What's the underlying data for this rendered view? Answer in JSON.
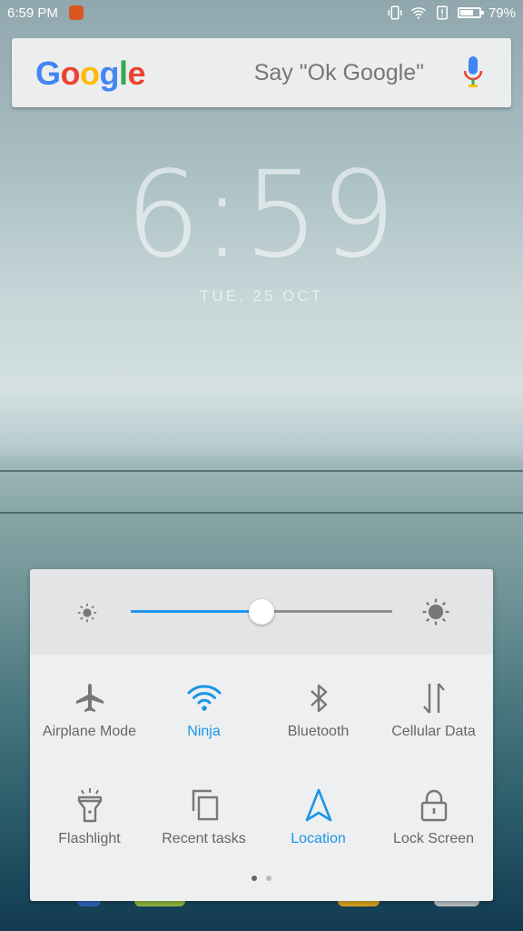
{
  "status_bar": {
    "time": "6:59 PM",
    "battery_percent": "79%",
    "battery_level": 0.79
  },
  "search": {
    "logo": [
      "G",
      "o",
      "o",
      "g",
      "l",
      "e"
    ],
    "hint": "Say \"Ok Google\""
  },
  "lockscreen": {
    "time": "6:59",
    "date": "TUE, 25 OCT"
  },
  "quick_settings": {
    "brightness_level": 0.5,
    "tiles": [
      {
        "label": "Airplane Mode",
        "icon": "airplane-icon",
        "active": false
      },
      {
        "label": "Ninja",
        "icon": "wifi-icon",
        "active": true
      },
      {
        "label": "Bluetooth",
        "icon": "bluetooth-icon",
        "active": false
      },
      {
        "label": "Cellular Data",
        "icon": "cellular-data-icon",
        "active": false
      },
      {
        "label": "Flashlight",
        "icon": "flashlight-icon",
        "active": false
      },
      {
        "label": "Recent tasks",
        "icon": "recent-tasks-icon",
        "active": false
      },
      {
        "label": "Location",
        "icon": "location-icon",
        "active": true
      },
      {
        "label": "Lock Screen",
        "icon": "lock-icon",
        "active": false
      }
    ],
    "page_indicator": {
      "pages": 2,
      "current": 1
    }
  },
  "colors": {
    "accent": "#2196f3",
    "active_label": "#1a96e6",
    "inactive_icon": "#777777"
  }
}
